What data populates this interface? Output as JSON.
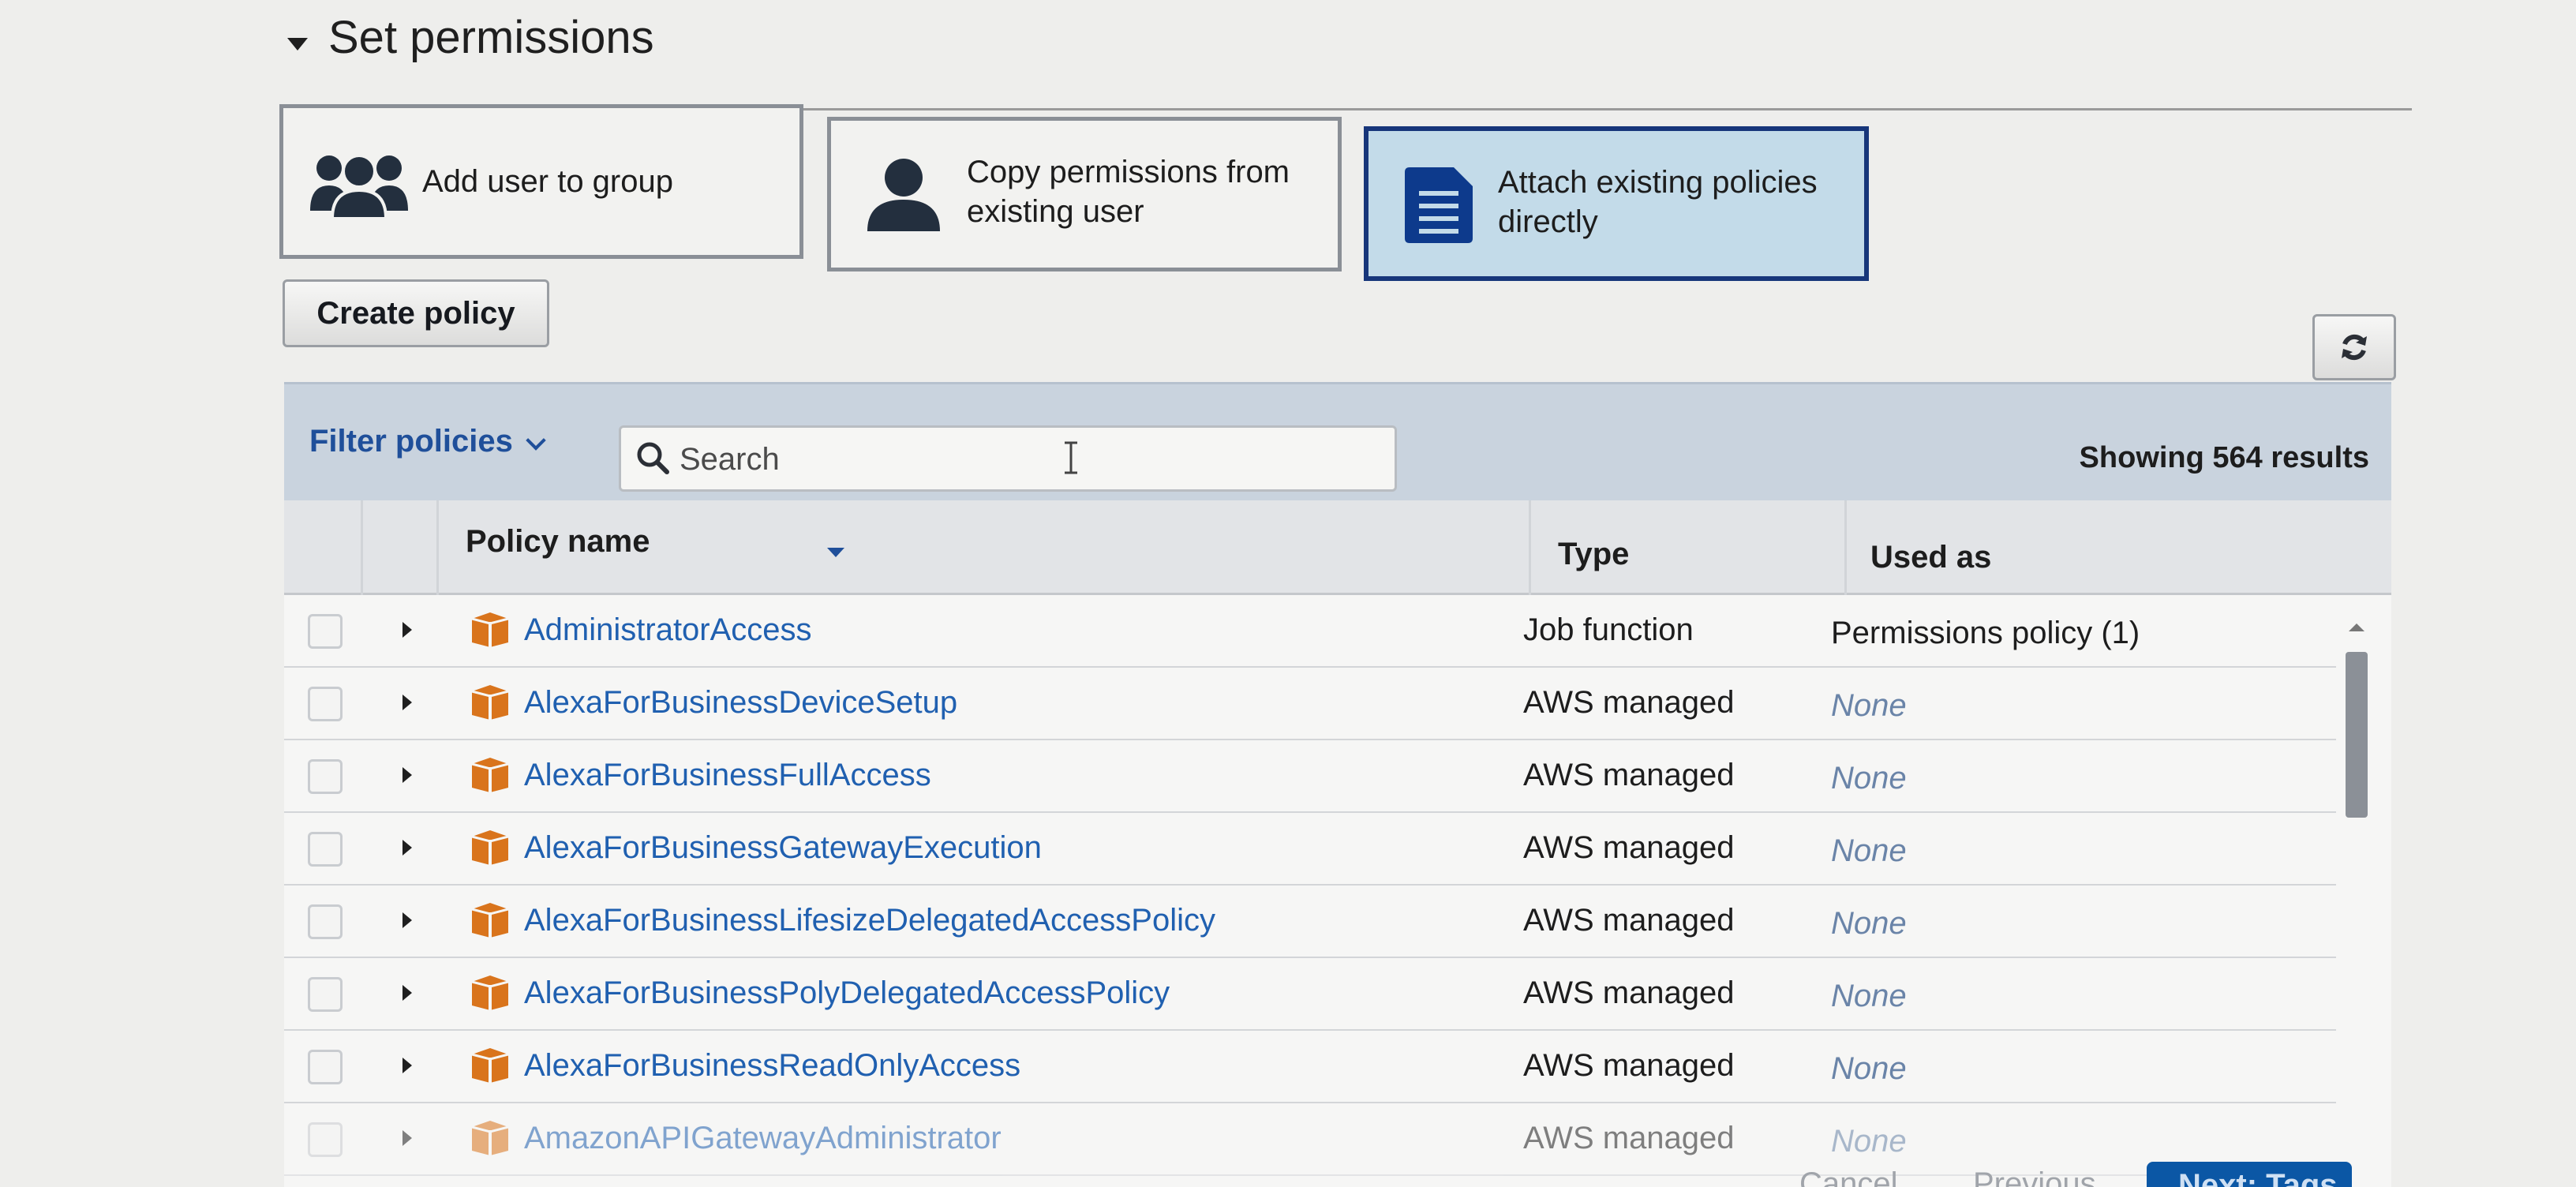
{
  "section": {
    "title": "Set permissions"
  },
  "options": [
    {
      "label": "Add user to group",
      "icon": "users-group-icon",
      "selected": false
    },
    {
      "label_line1": "Copy permissions from",
      "label_line2": "existing user",
      "icon": "user-icon",
      "selected": false
    },
    {
      "label_line1": "Attach existing policies",
      "label_line2": "directly",
      "icon": "document-icon",
      "selected": true
    }
  ],
  "toolbar": {
    "create_policy_label": "Create policy",
    "refresh_icon": "refresh-icon"
  },
  "filter": {
    "label": "Filter policies",
    "search_placeholder": "Search",
    "results_text": "Showing 564 results"
  },
  "columns": {
    "policy_name": "Policy name",
    "type": "Type",
    "used_as": "Used as"
  },
  "rows": [
    {
      "name": "AdministratorAccess",
      "type": "Job function",
      "used_as": "Permissions policy (1)"
    },
    {
      "name": "AlexaForBusinessDeviceSetup",
      "type": "AWS managed",
      "used_as": "None"
    },
    {
      "name": "AlexaForBusinessFullAccess",
      "type": "AWS managed",
      "used_as": "None"
    },
    {
      "name": "AlexaForBusinessGatewayExecution",
      "type": "AWS managed",
      "used_as": "None"
    },
    {
      "name": "AlexaForBusinessLifesizeDelegatedAccessPolicy",
      "type": "AWS managed",
      "used_as": "None"
    },
    {
      "name": "AlexaForBusinessPolyDelegatedAccessPolicy",
      "type": "AWS managed",
      "used_as": "None"
    },
    {
      "name": "AlexaForBusinessReadOnlyAccess",
      "type": "AWS managed",
      "used_as": "None"
    },
    {
      "name": "AmazonAPIGatewayAdministrator",
      "type": "AWS managed",
      "used_as": "None"
    }
  ],
  "footer": {
    "cancel_label": "Cancel",
    "previous_label": "Previous",
    "next_label": "Next: Tags"
  },
  "colors": {
    "accent_blue": "#2060b0",
    "selected_border": "#17367a",
    "selected_bg": "#c3dbe9",
    "policy_icon": "#d9741c"
  }
}
